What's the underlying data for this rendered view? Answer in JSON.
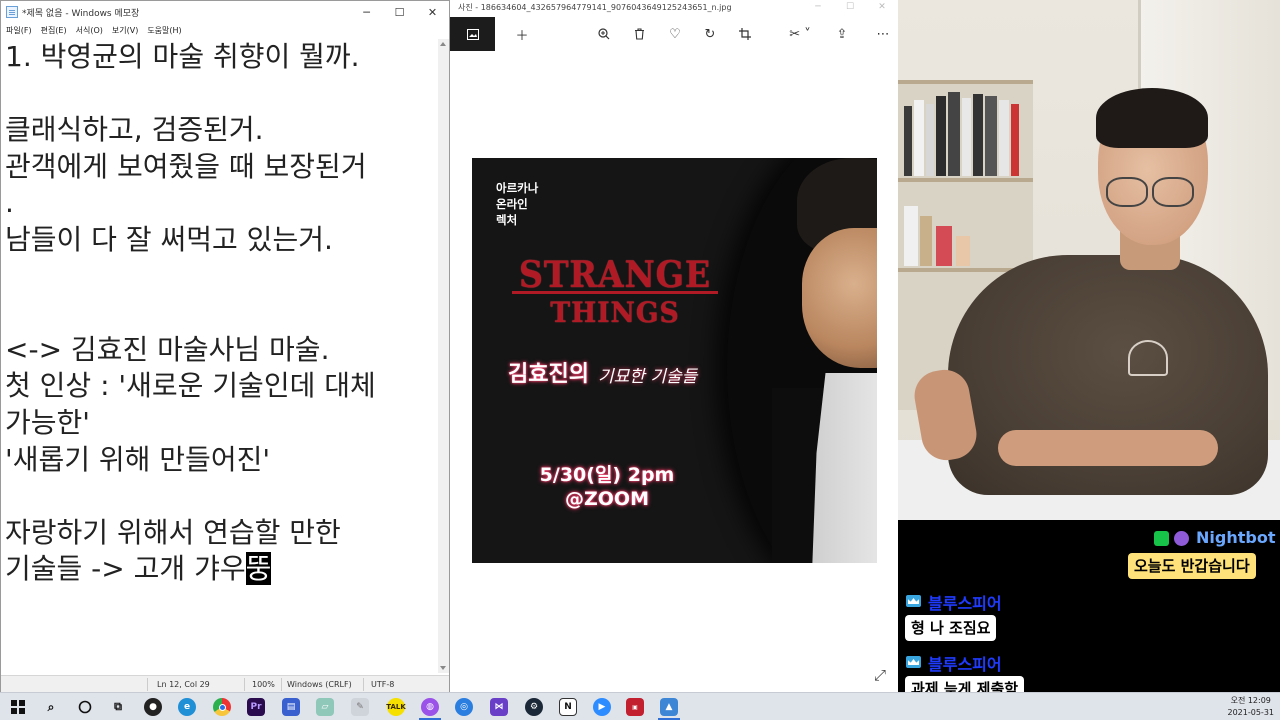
{
  "notepad": {
    "title": "*제목 없음 - Windows 메모장",
    "menu": [
      "파일(F)",
      "편집(E)",
      "서식(O)",
      "보기(V)",
      "도움말(H)"
    ],
    "lines": [
      "1. 박영균의 마술 취향이 뭘까.",
      "",
      "클래식하고, 검증된거.",
      "관객에게 보여줬을 때 보장된거",
      ".",
      "남들이 다 잘 써먹고 있는거.",
      "",
      "",
      "<-> 김효진 마술사님 마술.",
      "첫 인상 : '새로운 기술인데 대체",
      "가능한'",
      "'새롭기 위해 만들어진'",
      "",
      "자랑하기 위해서 연습할 만한",
      "기술들 -> 고개 갸우"
    ],
    "cursor_char": "뚱",
    "status": {
      "position": "Ln 12, Col 29",
      "zoom": "100%",
      "line_ending": "Windows (CRLF)",
      "encoding": "UTF-8"
    }
  },
  "photos": {
    "title": "사진 - 186634604_432657964779141_9076043649125243651_n.jpg",
    "toolbar": [
      "gallery-icon",
      "add-icon",
      "zoom-icon",
      "delete-icon",
      "favorite-icon",
      "rotate-icon",
      "crop-icon",
      "edit-icon",
      "share-icon",
      "more-icon"
    ]
  },
  "poster": {
    "org_line1": "아르카나",
    "org_line2": "온라인",
    "org_line3": "렉처",
    "title_top": "STRANGE",
    "title_bottom": "THINGS",
    "subtitle_name": "김효진의",
    "subtitle_rest": "기묘한 기술들",
    "date": "5/30(일) 2pm",
    "venue": "@ZOOM"
  },
  "chat": {
    "messages": [
      {
        "user": "Nightbot",
        "text": "오늘도 반갑습니다",
        "name_color": "#6aa8ff",
        "bubble_color": "#ffe27a"
      },
      {
        "user": "블루스피어",
        "text": "형 나 조짐요",
        "name_color": "#1f3bff",
        "bubble_color": "#ffffff"
      },
      {
        "user": "블루스피어",
        "text": "과제 늦게 제출함",
        "name_color": "#1f3bff",
        "bubble_color": "#ffffff"
      }
    ]
  },
  "taskbar": {
    "icons": [
      "windows-icon",
      "search-icon",
      "cortana-icon",
      "task-view-icon",
      "obs-icon",
      "edge-icon",
      "chrome-icon",
      "premiere-icon",
      "app-icon",
      "app-icon",
      "kakaotalk-icon",
      "purple-app-icon",
      "app-icon",
      "visual-studio-icon",
      "steam-icon",
      "notion-icon",
      "zoom-icon",
      "video-app-icon",
      "photos-icon"
    ],
    "clock_time": "오전 12:09",
    "clock_date": "2021-05-31"
  }
}
